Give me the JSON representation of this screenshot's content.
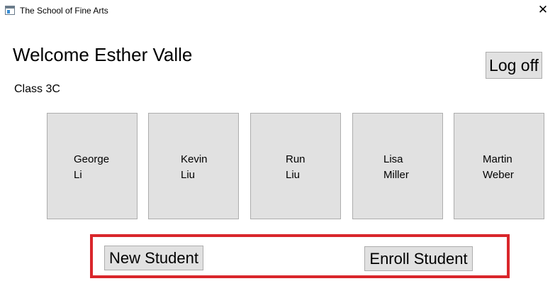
{
  "window": {
    "title": "The School of Fine Arts",
    "app_icon": "window-app-icon",
    "close_symbol": "✕"
  },
  "header": {
    "welcome": "Welcome Esther Valle",
    "class_label": "Class 3C",
    "logoff_label": "Log off"
  },
  "students": [
    {
      "first": "George",
      "last": "Li"
    },
    {
      "first": "Kevin",
      "last": "Liu"
    },
    {
      "first": "Run",
      "last": "Liu"
    },
    {
      "first": "Lisa",
      "last": "Miller"
    },
    {
      "first": "Martin",
      "last": "Weber"
    }
  ],
  "actions": {
    "new_student_label": "New Student",
    "enroll_student_label": "Enroll Student",
    "highlight_color": "#d9262b"
  },
  "colors": {
    "button_face": "#e1e1e1",
    "button_border": "#adadad"
  }
}
